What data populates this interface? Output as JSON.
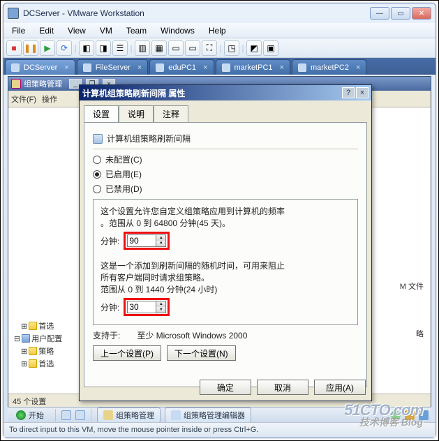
{
  "window": {
    "title": "DCServer - VMware Workstation",
    "menu": [
      "File",
      "Edit",
      "View",
      "VM",
      "Team",
      "Windows",
      "Help"
    ]
  },
  "tabs": [
    {
      "label": "DCServer",
      "active": true
    },
    {
      "label": "FileServer"
    },
    {
      "label": "eduPC1"
    },
    {
      "label": "marketPC1"
    },
    {
      "label": "marketPC2"
    }
  ],
  "mmc": {
    "title": "组策略管理",
    "menu": {
      "file": "文件(F)",
      "action": "操作"
    },
    "status": "45 个设置",
    "tree": {
      "a1": "首选",
      "a2": "用户配置",
      "a3": "策略",
      "a4": "首选"
    },
    "content": {
      "hint1": "M 文件",
      "hint2": "略"
    }
  },
  "dialog": {
    "title": "计算机组策略刷新间隔 属性",
    "tabs": {
      "setting": "设置",
      "explain": "说明",
      "comment": "注释"
    },
    "header": "计算机组策略刷新间隔",
    "radio": {
      "nc": "未配置(C)",
      "en": "已启用(E)",
      "dis": "已禁用(D)"
    },
    "block1": {
      "l1": "这个设置允许您自定义组策略应用到计算机的频率",
      "l2": "。范围从 0 到 64800 分钟(45 天)。",
      "label": "分钟:",
      "value": "90"
    },
    "block2": {
      "l1": "这是一个添加到刷新间隔的随机时间，可用来阻止",
      "l2": "所有客户端同时请求组策略。",
      "l3": "范围从 0 到 1440 分钟(24 小时)",
      "label": "分钟:",
      "value": "30"
    },
    "support_label": "支持于:",
    "support_value": "至少 Microsoft Windows 2000",
    "prev": "上一个设置(P)",
    "next": "下一个设置(N)",
    "ok": "确定",
    "cancel": "取消",
    "apply": "应用(A)"
  },
  "taskbar": {
    "start": "开始",
    "item1": "组策略管理",
    "item2": "组策略管理编辑器"
  },
  "status_line": "To direct input to this VM, move the mouse pointer inside or press Ctrl+G.",
  "watermark": {
    "a": "51CTO.com",
    "b": "技术博客 Blog"
  }
}
